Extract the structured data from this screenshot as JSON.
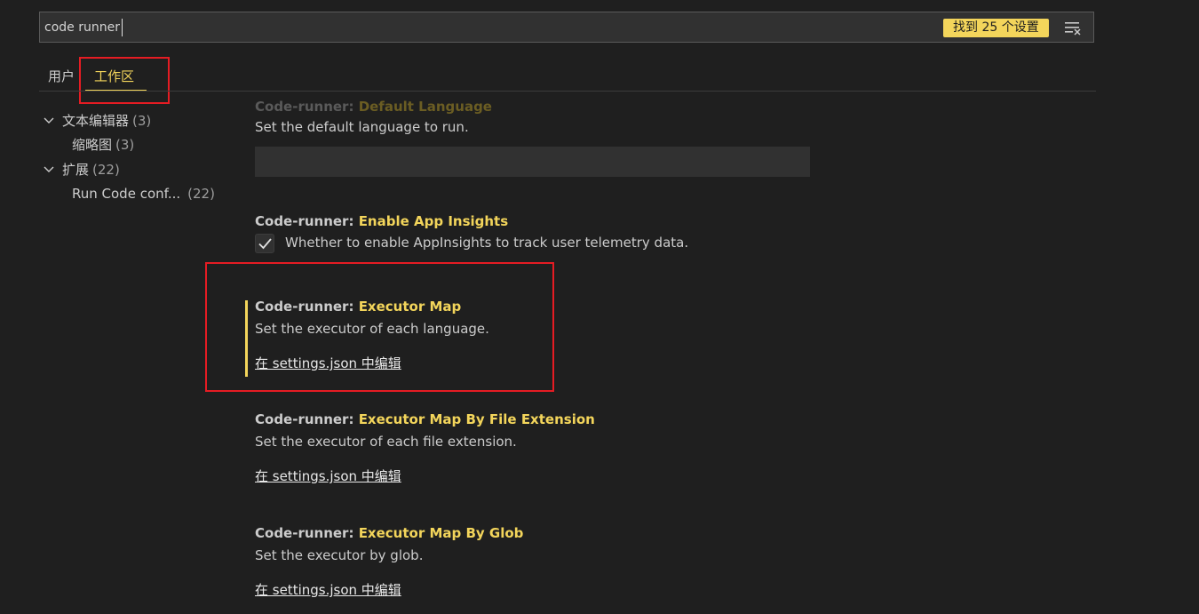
{
  "search": {
    "value": "code runner",
    "result_badge": "找到 25 个设置",
    "clear_icon": "clear-filter-icon"
  },
  "tabs": [
    {
      "label": "用户"
    },
    {
      "label": "工作区"
    }
  ],
  "tree": [
    {
      "label": "文本编辑器",
      "count": "(3)"
    },
    {
      "label": "缩略图",
      "count": "(3)"
    },
    {
      "label": "扩展",
      "count": "(22)"
    },
    {
      "label": "Run Code conf...",
      "count": "(22)"
    }
  ],
  "settings": {
    "default_language": {
      "prefix": "Code-runner: ",
      "name": "Default Language",
      "desc": "Set the default language to run.",
      "value": ""
    },
    "app_insights": {
      "prefix": "Code-runner: ",
      "name": "Enable App Insights",
      "desc": "Whether to enable AppInsights to track user telemetry data.",
      "checked": true
    },
    "executor_map": {
      "prefix": "Code-runner: ",
      "name": "Executor Map",
      "desc": "Set the executor of each language.",
      "link": "在 settings.json 中编辑"
    },
    "executor_map_ext": {
      "prefix": "Code-runner: ",
      "name": "Executor Map By File Extension",
      "desc": "Set the executor of each file extension.",
      "link": "在 settings.json 中编辑"
    },
    "executor_map_glob": {
      "prefix": "Code-runner: ",
      "name": "Executor Map By Glob",
      "desc": "Set the executor by glob.",
      "link": "在 settings.json 中编辑"
    }
  },
  "colors": {
    "accent": "#f3d55b",
    "background": "#1f1f1f",
    "highlight_border": "#e51c23"
  }
}
